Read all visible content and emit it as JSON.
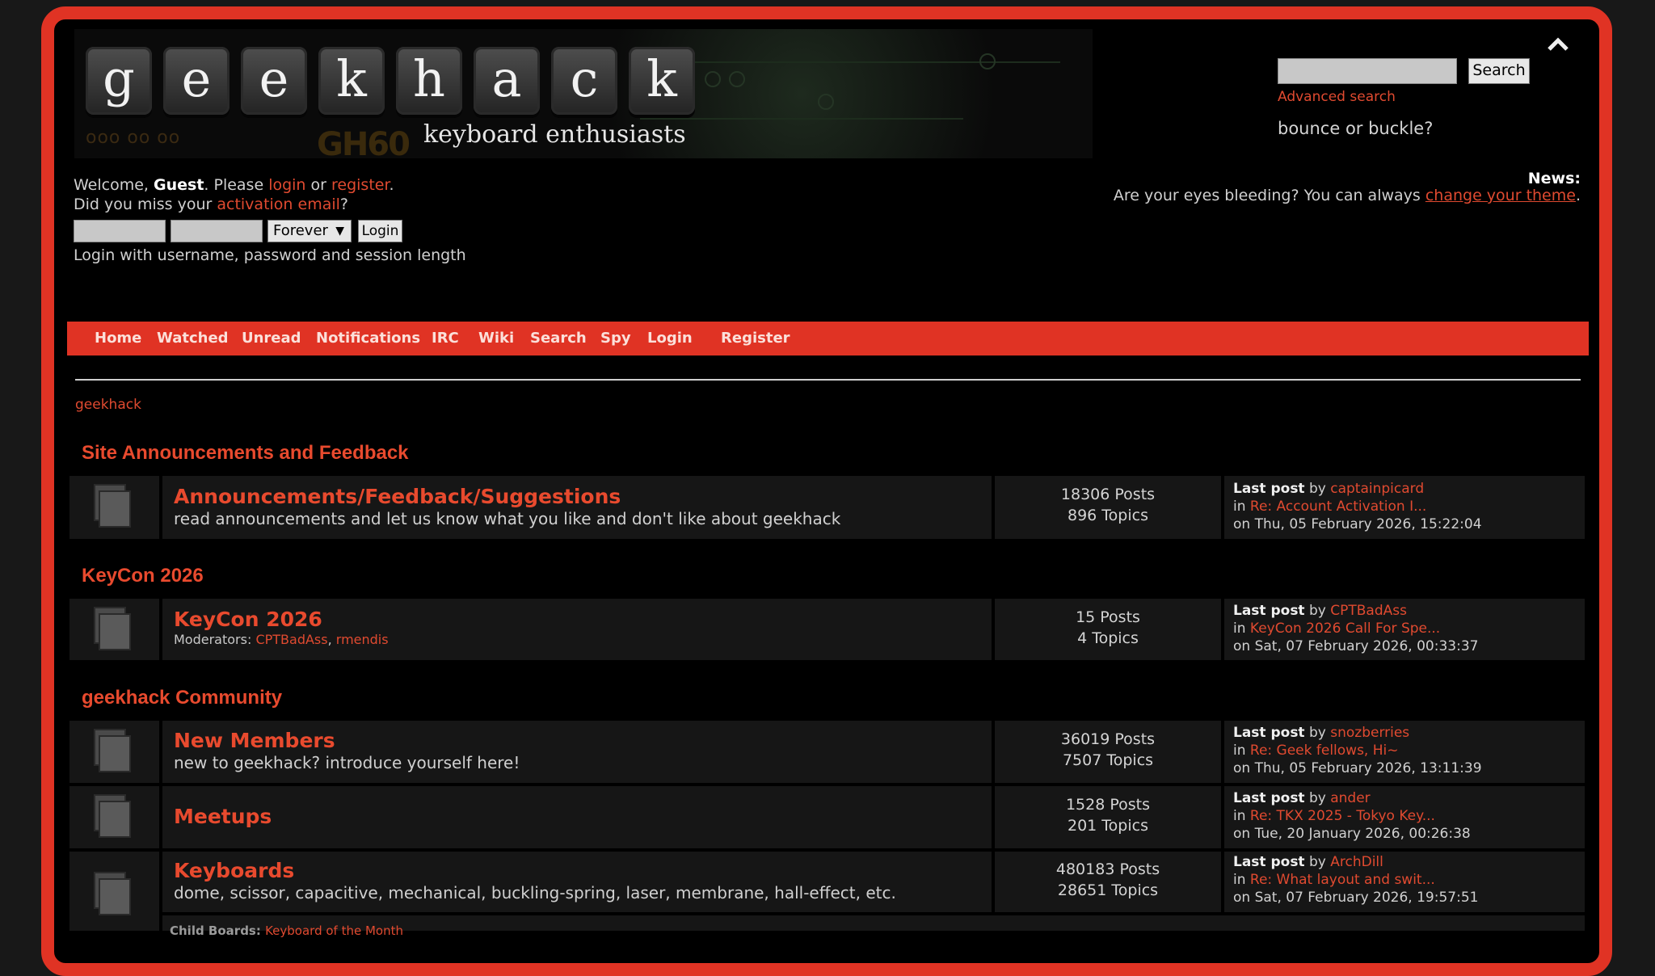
{
  "header": {
    "logo_letters": [
      "g",
      "e",
      "e",
      "k",
      "h",
      "a",
      "c",
      "k"
    ],
    "logo_mark": "GH60",
    "tagline": "keyboard enthusiasts",
    "search_button": "Search",
    "advanced_search": "Advanced search",
    "random_tagline": "bounce or buckle?",
    "upshrink_icon": "chevron-up-icon"
  },
  "user": {
    "welcome_prefix": "Welcome, ",
    "name": "Guest",
    "please": ". Please ",
    "login": "login",
    "or": " or ",
    "register": "register",
    "period": ".",
    "miss_prefix": "Did you miss your ",
    "activation": "activation email",
    "question": "?",
    "session_option": "Forever",
    "login_button": "Login",
    "hint": "Login with username, password and session length"
  },
  "news": {
    "title": "News:",
    "text": "Are your eyes bleeding?  You can always ",
    "link": "change your theme",
    "end": "."
  },
  "menu": [
    "Home",
    "Watched",
    "Unread",
    "Notifications",
    "IRC",
    "Wiki",
    "Search",
    "Spy",
    "Login",
    "Register"
  ],
  "breadcrumb": "geekhack",
  "categories": [
    {
      "title": "Site Announcements and Feedback",
      "boards": [
        {
          "name": "Announcements/Feedback/Suggestions",
          "desc": "read announcements and let us know what you like and don't like about geekhack",
          "posts": "18306 Posts",
          "topics": "896 Topics",
          "lp_by": "captainpicard",
          "lp_in": "Re: Account Activation I...",
          "lp_on": "on Thu, 05 February 2026, 15:22:04"
        }
      ]
    },
    {
      "title": "KeyCon 2026",
      "boards": [
        {
          "name": "KeyCon 2026",
          "mods_label": "Moderators: ",
          "mod1": "CPTBadAss",
          "mod_sep": ", ",
          "mod2": "rmendis",
          "posts": "15 Posts",
          "topics": "4 Topics",
          "lp_by": "CPTBadAss",
          "lp_in": "KeyCon 2026 Call For Spe...",
          "lp_on": "on Sat, 07 February 2026, 00:33:37"
        }
      ]
    },
    {
      "title": "geekhack Community",
      "boards": [
        {
          "name": "New Members",
          "desc": "new to geekhack? introduce yourself here!",
          "posts": "36019 Posts",
          "topics": "7507 Topics",
          "lp_by": "snozberries",
          "lp_in": "Re: Geek fellows, Hi~",
          "lp_on": "on Thu, 05 February 2026, 13:11:39"
        },
        {
          "name": "Meetups",
          "posts": "1528 Posts",
          "topics": "201 Topics",
          "lp_by": "ander",
          "lp_in": "Re: TKX 2025 - Tokyo Key...",
          "lp_on": "on Tue, 20 January 2026, 00:26:38"
        },
        {
          "name": "Keyboards",
          "desc": "dome, scissor, capacitive, mechanical, buckling-spring, laser, membrane, hall-effect, etc.",
          "posts": "480183 Posts",
          "topics": "28651 Topics",
          "lp_by": "ArchDill",
          "lp_in": "Re: What layout and swit...",
          "lp_on": "on Sat, 07 February 2026, 19:57:51",
          "child_label": "Child Boards: ",
          "child": "Keyboard of the Month"
        }
      ]
    }
  ],
  "lastpost_labels": {
    "last": "Last post",
    "by": " by ",
    "in": "in "
  },
  "colors": {
    "accent": "#e03324",
    "link": "#e04a30",
    "background": "#000000"
  }
}
